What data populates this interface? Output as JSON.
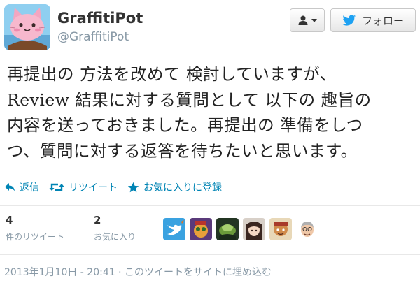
{
  "user": {
    "display_name": "GraffitiPot",
    "screen_name": "@GraffitiPot",
    "avatar_icon": "pink-cat-icon"
  },
  "header": {
    "follow_label": "フォロー",
    "brand_color": "#1da1f2"
  },
  "tweet": {
    "lines": [
      "再提出の 方法を改めて 検討していますが、",
      "Review 結果に対する質問として 以下の 趣旨の",
      "内容を送っておきました。再提出の 準備をしつ",
      "つ、質問に対する返答を待ちたいと思います。"
    ]
  },
  "actions": {
    "reply": "返信",
    "retweet": "リツイート",
    "favorite": "お気に入りに登録",
    "accent_color": "#0084b4"
  },
  "stats": {
    "retweets": {
      "count": "4",
      "label": "件のリツイート"
    },
    "favorites": {
      "count": "2",
      "label": "お気に入り"
    }
  },
  "favoriters": [
    "twitter-bird-avatar",
    "cartoon-face-avatar",
    "green-creature-avatar",
    "anime-girl-avatar",
    "cartoon-character-avatar",
    "old-man-avatar"
  ],
  "footer": {
    "timestamp": "2013年1月10日 - 20:41 · このツイートをサイトに埋め込む"
  }
}
